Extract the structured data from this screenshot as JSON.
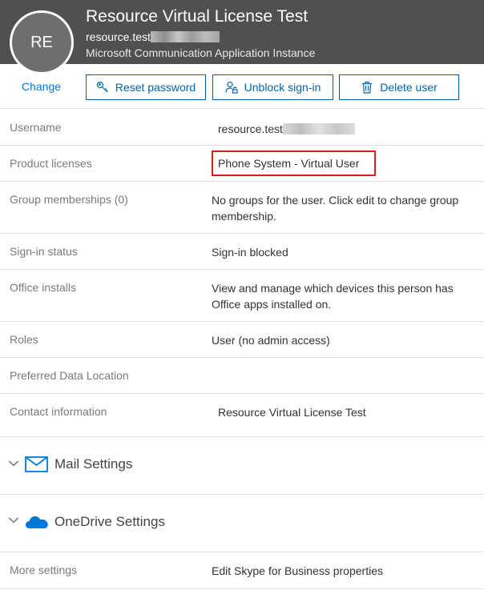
{
  "header": {
    "avatar_initials": "RE",
    "title": "Resource Virtual License Test",
    "upn_prefix": "resource.test",
    "subtitle": "Microsoft Communication Application Instance"
  },
  "actions": {
    "change": "Change",
    "reset_password": "Reset password",
    "unblock_signin": "Unblock sign-in",
    "delete_user": "Delete user"
  },
  "properties": {
    "username": {
      "label": "Username",
      "value": "resource.test"
    },
    "product_licenses": {
      "label": "Product licenses",
      "value": "Phone System - Virtual User"
    },
    "group_memberships": {
      "label": "Group memberships (0)",
      "value": "No groups for the user. Click edit to change group membership."
    },
    "signin_status": {
      "label": "Sign-in status",
      "value": "Sign-in blocked"
    },
    "office_installs": {
      "label": "Office installs",
      "value": "View and manage which devices this person has Office apps installed on."
    },
    "roles": {
      "label": "Roles",
      "value": "User (no admin access)"
    },
    "preferred_data_location": {
      "label": "Preferred Data Location",
      "value": ""
    },
    "contact_information": {
      "label": "Contact information",
      "value": "Resource Virtual License Test"
    }
  },
  "sections": {
    "mail": "Mail Settings",
    "onedrive": "OneDrive Settings"
  },
  "more_settings": {
    "label": "More settings",
    "link": "Edit Skype for Business properties"
  },
  "colors": {
    "header_bg": "#505050",
    "accent": "#0078d7",
    "highlight_border": "#d21f1f"
  }
}
